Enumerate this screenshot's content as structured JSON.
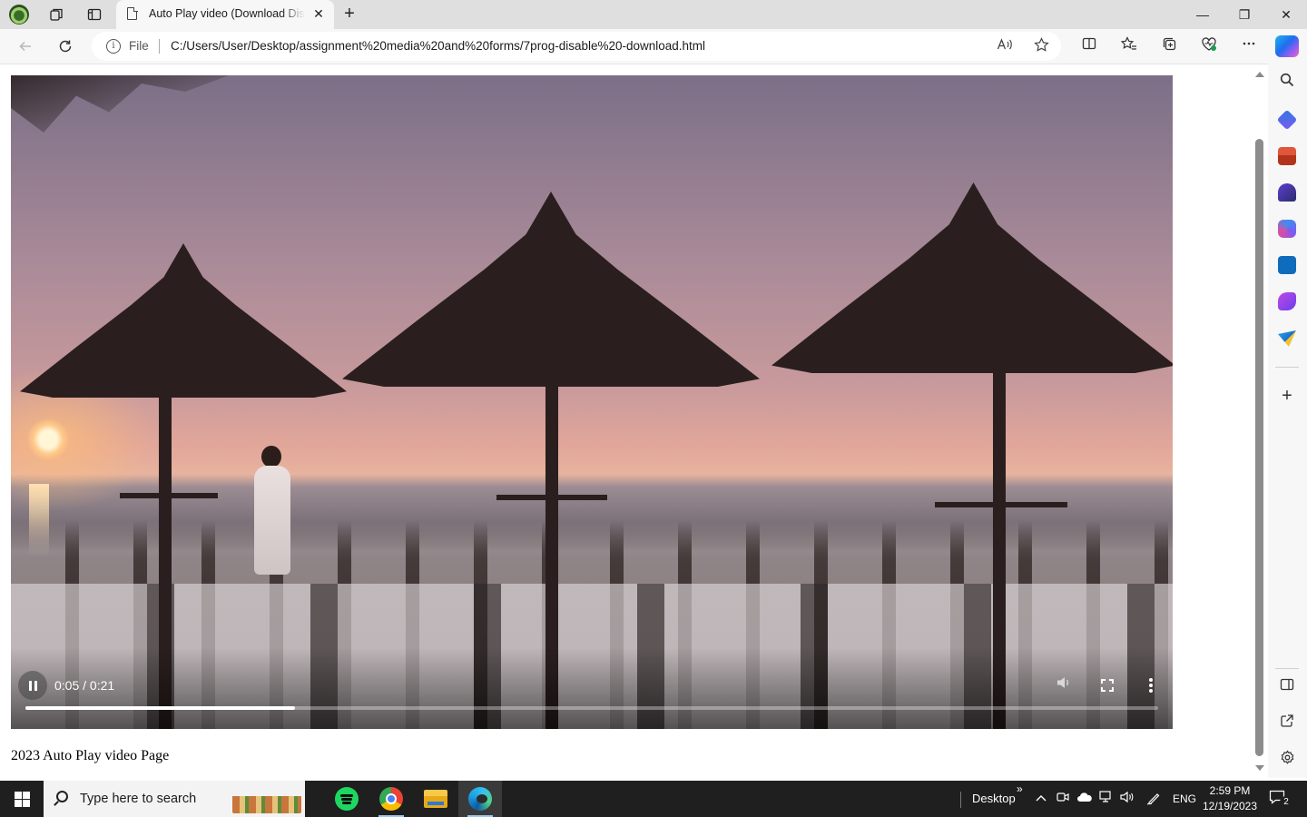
{
  "browser": {
    "tab_title": "Auto Play video (Download Disable)",
    "new_tab_symbol": "+",
    "tab_close_symbol": "✕",
    "address": {
      "scheme_label": "File",
      "url": "C:/Users/User/Desktop/assignment%20media%20and%20forms/7prog-disable%20-download.html"
    },
    "window_controls": {
      "minimize": "—",
      "restore": "❐",
      "close": "✕"
    },
    "toolbar_icons": [
      "read-aloud-icon",
      "favorite-star-icon",
      "split-screen-icon",
      "favorites-icon",
      "collections-icon",
      "browser-essentials-icon",
      "more-menu-icon"
    ],
    "sidebar_icons": [
      "search-icon",
      "shopping-icon",
      "tools-icon",
      "games-icon",
      "microsoft-365-icon",
      "outlook-icon",
      "designer-icon",
      "drop-icon",
      "add-icon",
      "sidebar-toggle-icon",
      "open-external-icon",
      "settings-icon"
    ]
  },
  "page": {
    "video": {
      "time_display": "0:05 / 0:21",
      "current_seconds": 5,
      "duration_seconds": 21,
      "state": "playing"
    },
    "caption": "2023 Auto Play video Page"
  },
  "taskbar": {
    "search_placeholder": "Type here to search",
    "apps": [
      "spotify-icon",
      "chrome-icon",
      "file-explorer-icon",
      "edge-icon"
    ],
    "active_app": "edge",
    "desktop_label": "Desktop",
    "desktop_more": "»",
    "language": "ENG",
    "time": "2:59 PM",
    "date": "12/19/2023",
    "notification_count": "2"
  },
  "colors": {
    "tab_bar": "#dfdfdf",
    "toolbar": "#f7f7f7",
    "taskbar": "#1f1f1f",
    "video_bg": "#000000",
    "copilot_accent": "#1f6cf0"
  }
}
